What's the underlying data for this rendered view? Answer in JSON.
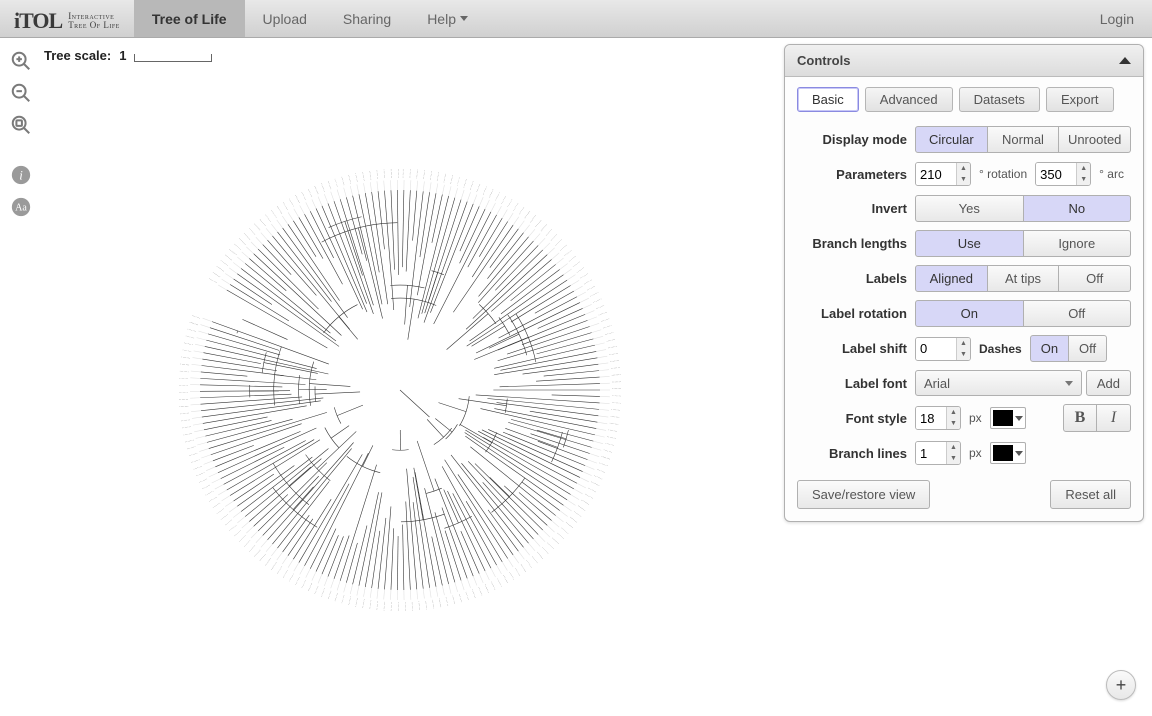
{
  "nav": {
    "logo_main": "iTOL",
    "logo_sub1": "Interactive",
    "logo_sub2": "Tree Of Life",
    "items": [
      {
        "label": "Tree of Life",
        "active": true
      },
      {
        "label": "Upload",
        "active": false
      },
      {
        "label": "Sharing",
        "active": false
      },
      {
        "label": "Help",
        "active": false,
        "dropdown": true
      }
    ],
    "login": "Login"
  },
  "tree_scale": {
    "label": "Tree scale:",
    "value": "1"
  },
  "tools": {
    "zoom_in": "zoom-in-icon",
    "zoom_out": "zoom-out-icon",
    "zoom_fit": "zoom-fit-icon",
    "info": "info-icon",
    "font": "font-icon"
  },
  "fab": {
    "label": "+"
  },
  "controls": {
    "title": "Controls",
    "tabs": [
      "Basic",
      "Advanced",
      "Datasets",
      "Export"
    ],
    "active_tab": "Basic",
    "display_mode": {
      "label": "Display mode",
      "options": [
        "Circular",
        "Normal",
        "Unrooted"
      ],
      "selected": "Circular"
    },
    "parameters": {
      "label": "Parameters",
      "rotation_value": "210",
      "rotation_unit": "° rotation",
      "arc_value": "350",
      "arc_unit": "° arc"
    },
    "invert": {
      "label": "Invert",
      "options": [
        "Yes",
        "No"
      ],
      "selected": "No"
    },
    "branch_lengths": {
      "label": "Branch lengths",
      "options": [
        "Use",
        "Ignore"
      ],
      "selected": "Use"
    },
    "labels": {
      "label": "Labels",
      "options": [
        "Aligned",
        "At tips",
        "Off"
      ],
      "selected": "Aligned"
    },
    "label_rotation": {
      "label": "Label rotation",
      "options": [
        "On",
        "Off"
      ],
      "selected": "On"
    },
    "label_shift": {
      "label": "Label shift",
      "value": "0",
      "dashes_label": "Dashes",
      "dashes_options": [
        "On",
        "Off"
      ],
      "dashes_selected": "On"
    },
    "label_font": {
      "label": "Label font",
      "value": "Arial",
      "add": "Add"
    },
    "font_style": {
      "label": "Font style",
      "size": "18",
      "unit": "px",
      "color": "#000000",
      "bold": "B",
      "italic": "I"
    },
    "branch_lines": {
      "label": "Branch lines",
      "size": "1",
      "unit": "px",
      "color": "#000000"
    },
    "footer": {
      "save": "Save/restore view",
      "reset": "Reset all"
    }
  }
}
